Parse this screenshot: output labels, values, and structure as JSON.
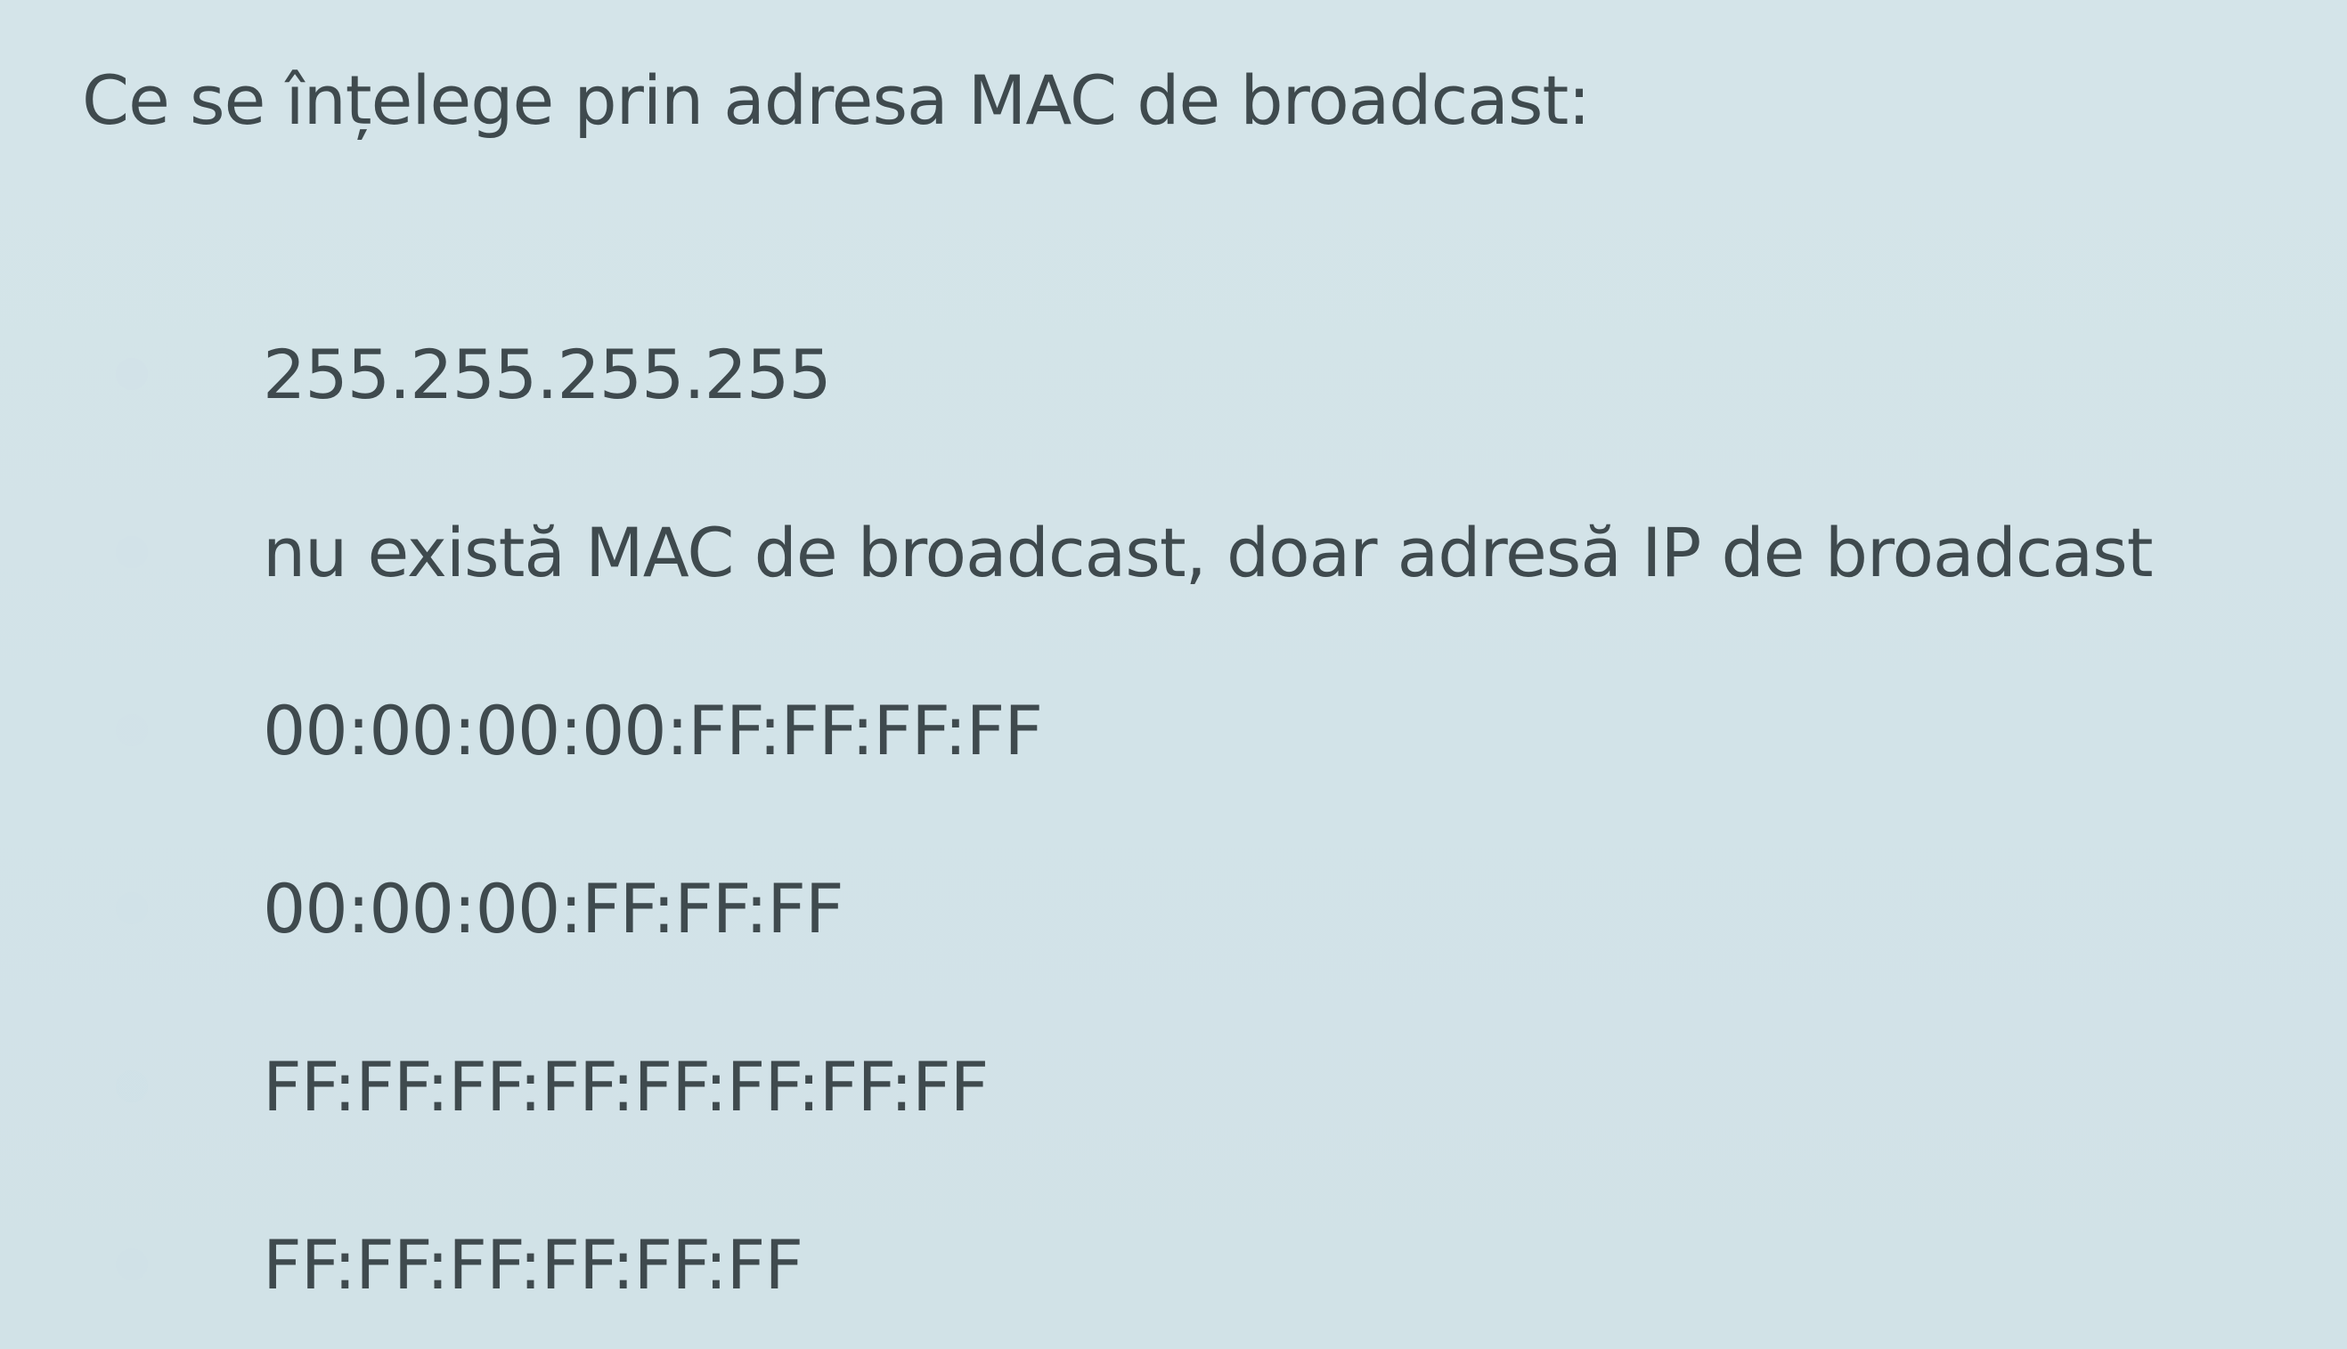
{
  "question": {
    "text": "Ce se înțelege prin adresa MAC de broadcast:"
  },
  "answers": [
    {
      "label": "255.255.255.255"
    },
    {
      "label": "nu există MAC de broadcast, doar adresă IP de broadcast"
    },
    {
      "label": "00:00:00:00:FF:FF:FF:FF"
    },
    {
      "label": "00:00:00:FF:FF:FF"
    },
    {
      "label": "FF:FF:FF:FF:FF:FF:FF:FF"
    },
    {
      "label": "FF:FF:FF:FF:FF:FF"
    }
  ],
  "colors": {
    "background": "#d2e3e8",
    "text": "#3f4a4e"
  }
}
